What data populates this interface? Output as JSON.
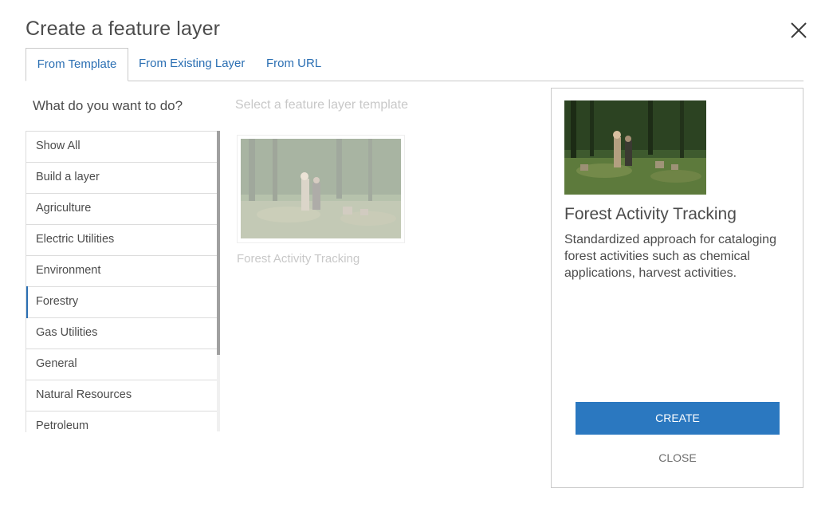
{
  "dialog": {
    "title": "Create a feature layer"
  },
  "tabs": [
    {
      "label": "From Template",
      "active": true
    },
    {
      "label": "From Existing Layer",
      "active": false
    },
    {
      "label": "From URL",
      "active": false
    }
  ],
  "left": {
    "question": "What do you want to do?",
    "categories": [
      {
        "label": "Show All"
      },
      {
        "label": "Build a layer"
      },
      {
        "label": "Agriculture"
      },
      {
        "label": "Electric Utilities"
      },
      {
        "label": "Environment"
      },
      {
        "label": "Forestry",
        "selected": true
      },
      {
        "label": "Gas Utilities"
      },
      {
        "label": "General"
      },
      {
        "label": "Natural Resources"
      },
      {
        "label": "Petroleum"
      }
    ]
  },
  "middle": {
    "hint": "Select a feature layer template",
    "templates": [
      {
        "name": "Forest Activity Tracking"
      }
    ]
  },
  "detail": {
    "title": "Forest Activity Tracking",
    "description": "Standardized approach for cataloging forest activities such as chemical applications, harvest activities.",
    "create_label": "CREATE",
    "close_label": "CLOSE"
  },
  "colors": {
    "accent": "#2b78c0",
    "link": "#2b6fb3",
    "text": "#4c4c4c",
    "muted": "#c8c8c8"
  },
  "icons": {
    "close": "close-icon"
  }
}
